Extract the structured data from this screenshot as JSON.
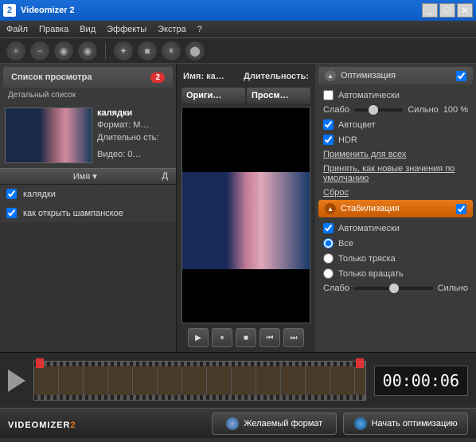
{
  "window": {
    "title": "Videomizer 2",
    "icon_label": "2"
  },
  "menu": {
    "file": "Файл",
    "edit": "Правка",
    "view": "Вид",
    "effects": "Эффекты",
    "extra": "Экстра",
    "help": "?"
  },
  "left": {
    "header": "Список просмотра",
    "badge": "2",
    "subtitle": "Детальный список",
    "thumb": {
      "name": "калядки",
      "format_label": "Формат:",
      "format_value": "M…",
      "duration_label": "Длительно сть:",
      "video_label": "Видео:",
      "video_value": "0…"
    },
    "col_name": "Имя ▾",
    "col_d": "Д",
    "rows": [
      {
        "checked": true,
        "name": "калядки"
      },
      {
        "checked": true,
        "name": "как открыть шампанское"
      }
    ]
  },
  "mid": {
    "name_label": "Имя: ка…",
    "duration_label": "Длительность:",
    "tab_original": "Ориги…",
    "tab_preview": "Просм…"
  },
  "right": {
    "opt": {
      "title": "Оптимизация",
      "auto": "Автоматически",
      "weak": "Слабо",
      "strong": "Сильно",
      "pct": "100 %",
      "autocolor": "Автоцвет",
      "hdr": "HDR",
      "apply_all": "Применить для всех",
      "accept_defaults": "Принять, как новые значения по умолчанию",
      "reset": "Сброс"
    },
    "stab": {
      "title": "Стабилизация",
      "auto": "Автоматически",
      "all": "Все",
      "shake": "Только тряска",
      "rotate": "Только вращать",
      "weak": "Слабо",
      "strong": "Сильно"
    }
  },
  "timeline": {
    "timecode": "00:00:06"
  },
  "footer": {
    "logo_text": "VIDEOMIZER",
    "format_btn": "Желаемый формат",
    "optimize_btn": "Начать оптимизацию"
  }
}
